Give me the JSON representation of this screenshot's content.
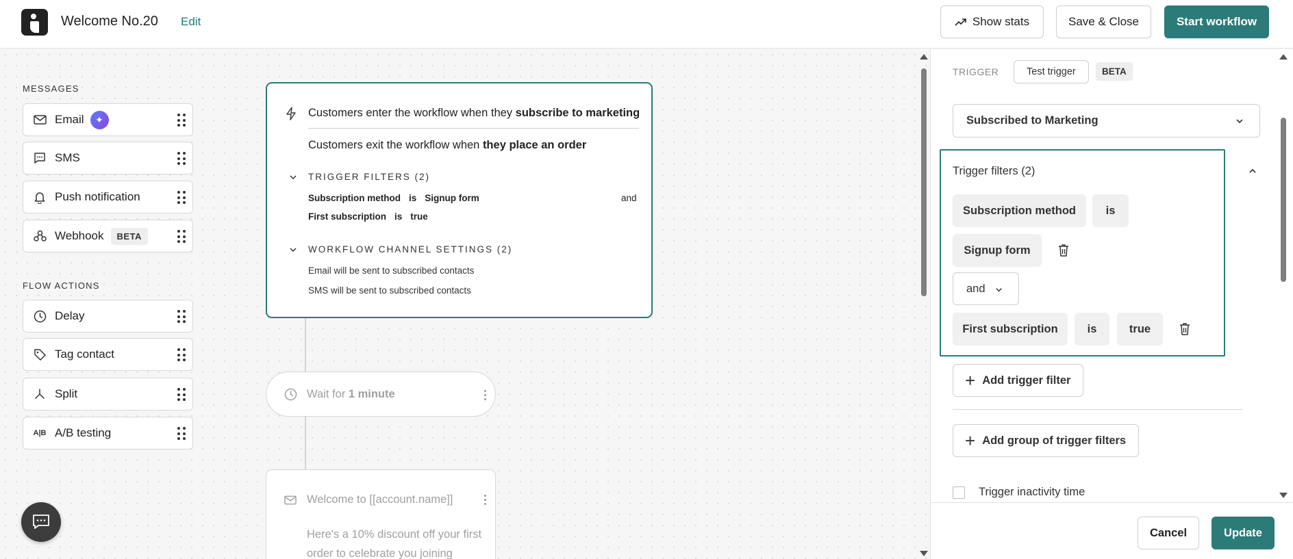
{
  "header": {
    "title": "Welcome No.20",
    "edit_label": "Edit",
    "show_stats_label": "Show stats",
    "save_close_label": "Save & Close",
    "start_label": "Start workflow",
    "accent_color": "#2b7b79"
  },
  "sidebar": {
    "messages_heading": "MESSAGES",
    "messages": [
      {
        "label": "Email",
        "icon": "envelope-icon"
      },
      {
        "label": "SMS",
        "icon": "chat-icon"
      },
      {
        "label": "Push notification",
        "icon": "bell-icon"
      },
      {
        "label": "Webhook",
        "icon": "webhook-icon",
        "badge": "BETA"
      }
    ],
    "flow_heading": "FLOW ACTIONS",
    "flow": [
      {
        "label": "Delay",
        "icon": "clock-icon"
      },
      {
        "label": "Tag contact",
        "icon": "tag-icon"
      },
      {
        "label": "Split",
        "icon": "split-icon"
      },
      {
        "label": "A/B testing",
        "icon": "ab-icon",
        "glyph": "A|B"
      }
    ]
  },
  "trigger_card": {
    "enter_prefix": "Customers enter the workflow when they ",
    "enter_bold": "subscribe to marketing",
    "exit_prefix": "Customers exit the workflow when ",
    "exit_bold": "they place an order",
    "filters_heading": "TRIGGER FILTERS (2)",
    "filter1": {
      "field": "Subscription method",
      "op": "is",
      "value": "Signup form"
    },
    "filter2": {
      "field": "First subscription",
      "op": "is",
      "value": "true"
    },
    "and_label": "and",
    "settings_heading": "WORKFLOW CHANNEL SETTINGS (2)",
    "setting1": "Email will be sent to subscribed contacts",
    "setting2": "SMS will be sent to subscribed contacts"
  },
  "wait_card": {
    "prefix": "Wait for ",
    "bold": "1 minute"
  },
  "email_card": {
    "title": "Welcome to [[account.name]]",
    "body": "Here's a 10% discount off your first order to celebrate you joining"
  },
  "panel": {
    "trigger_label": "TRIGGER",
    "test_trigger_label": "Test trigger",
    "beta_label": "BETA",
    "selected_trigger": "Subscribed to Marketing",
    "filters_title": "Trigger filters (2)",
    "filter1": {
      "field": "Subscription method",
      "op": "is",
      "value": "Signup form"
    },
    "connector": "and",
    "filter2": {
      "field": "First subscription",
      "op": "is",
      "value": "true"
    },
    "add_filter_label": "Add trigger filter",
    "add_group_label": "Add group of trigger filters",
    "inactivity_label": "Trigger inactivity time",
    "cancel_label": "Cancel",
    "update_label": "Update"
  }
}
